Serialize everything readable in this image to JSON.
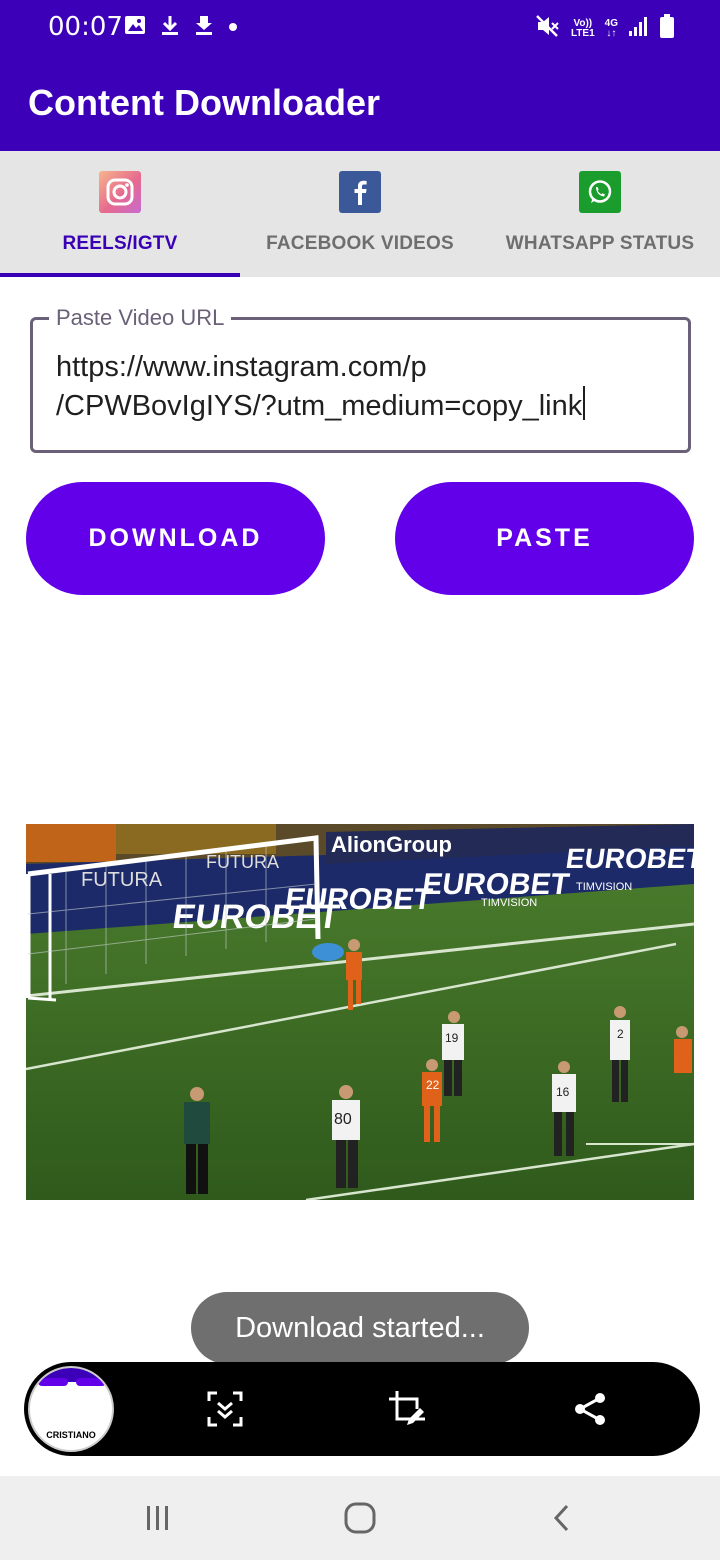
{
  "status_bar": {
    "time": "00:07",
    "left_icons": [
      "image-icon",
      "download-icon",
      "download-progress-icon",
      "dot-icon"
    ],
    "network_top": "Vo))",
    "network_bottom": "LTE1",
    "network_type": "4G",
    "right_icons": [
      "mute-icon",
      "signal-icon",
      "battery-icon"
    ]
  },
  "app_bar": {
    "title": "Content Downloader",
    "color": "#3b00b8"
  },
  "tabs": [
    {
      "label": "REELS/IGTV",
      "icon": "instagram-icon",
      "active": true
    },
    {
      "label": "FACEBOOK VIDEOS",
      "icon": "facebook-icon",
      "active": false
    },
    {
      "label": "WHATSAPP STATUS",
      "icon": "whatsapp-icon",
      "active": false
    }
  ],
  "url_field": {
    "label": "Paste Video URL",
    "value_line1": "https://www.instagram.com/p",
    "value_line2": "/CPWBovIgIYS/?utm_medium=copy_link"
  },
  "buttons": {
    "download": "DOWNLOAD",
    "paste": "PASTE",
    "color": "#6200ea"
  },
  "video_preview": {
    "description_icon": "soccer-video-thumbnail",
    "ad_boards": [
      "EUROBET",
      "EUROBET",
      "EUROBET",
      "EUROBET",
      "FUTURA",
      "TIMVISION",
      "TIMVISION"
    ],
    "player_numbers": [
      "19",
      "2",
      "22",
      "16",
      "80"
    ]
  },
  "toast": {
    "message": "Download started..."
  },
  "screenshot_toolbar": {
    "thumbnail_label": "CRISTIANO",
    "icons": [
      "scroll-capture-icon",
      "crop-edit-icon",
      "share-icon"
    ]
  },
  "nav_bar": {
    "icons": [
      "recents-icon",
      "home-icon",
      "back-icon"
    ]
  }
}
